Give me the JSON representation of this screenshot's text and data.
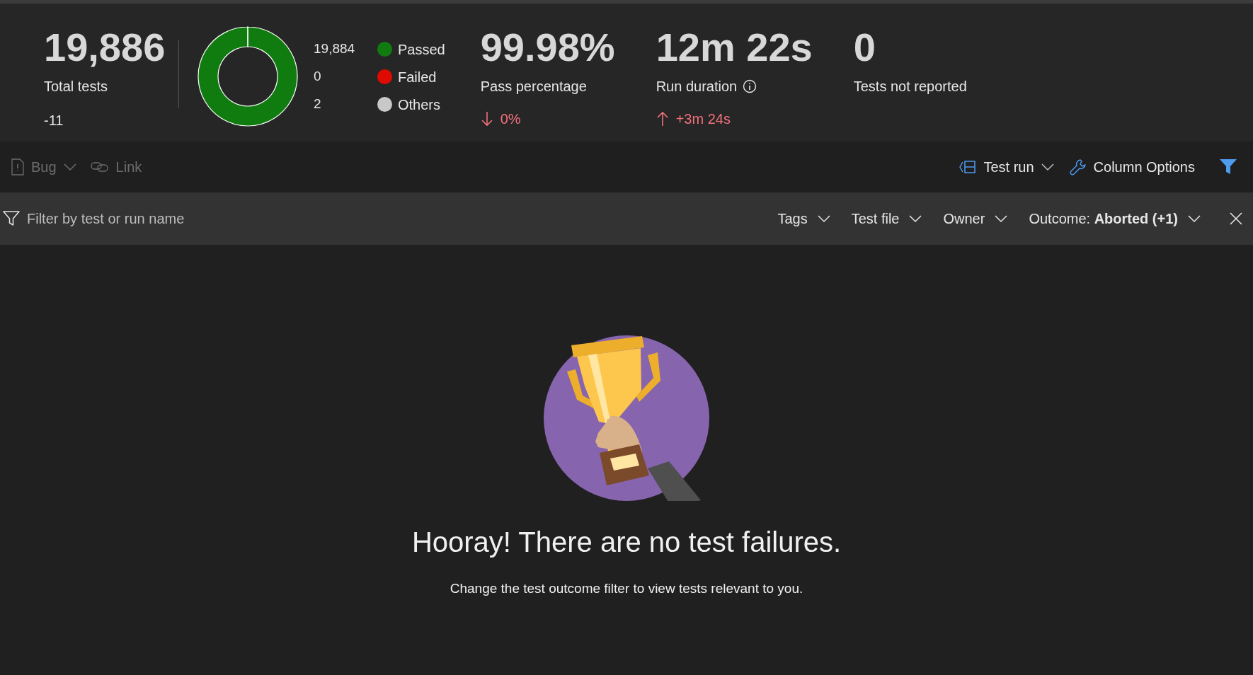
{
  "summary": {
    "total": {
      "value": "19,886",
      "label": "Total tests",
      "change": "-11"
    },
    "chart_data": {
      "type": "donut",
      "categories": [
        "Passed",
        "Failed",
        "Others"
      ],
      "values": [
        99.99,
        0,
        0.01
      ]
    },
    "legend": [
      {
        "count": "19,884",
        "color": "#107c10"
      },
      {
        "count": "0",
        "color": "#e00b00"
      },
      {
        "count": "2",
        "color": "#c8c8c8"
      }
    ],
    "metrics": [
      {
        "value": "99.98%",
        "label": "Pass percentage",
        "info": false,
        "kind": "down",
        "change": "0%"
      },
      {
        "value": "12m 22s",
        "label": "Run duration",
        "info": true,
        "kind": "up",
        "change": "+3m 24s"
      },
      {
        "value": "0",
        "label": "Tests not reported",
        "info": false
      }
    ]
  },
  "toolbar": {
    "left": [
      {
        "kind": "bug",
        "label": "Bug",
        "dropdown": true,
        "disabled": true
      },
      {
        "kind": "link",
        "label": "Link",
        "dropdown": false,
        "disabled": true
      }
    ],
    "right": [
      {
        "kind": "testrun",
        "label": "Test run",
        "dropdown": true
      },
      {
        "kind": "columns",
        "label": "Column Options",
        "dropdown": false
      }
    ],
    "filter_toggle": {
      "active": true
    }
  },
  "filter_bar": {
    "placeholder": "Filter by test or run name",
    "filters": [
      "Tags",
      "Test file",
      "Owner",
      "Outcome: **Aborted (+1)**"
    ]
  },
  "empty_state": {
    "title": "Hooray! There are no test failures.",
    "message": "Change the test outcome filter to view tests relevant to you."
  }
}
